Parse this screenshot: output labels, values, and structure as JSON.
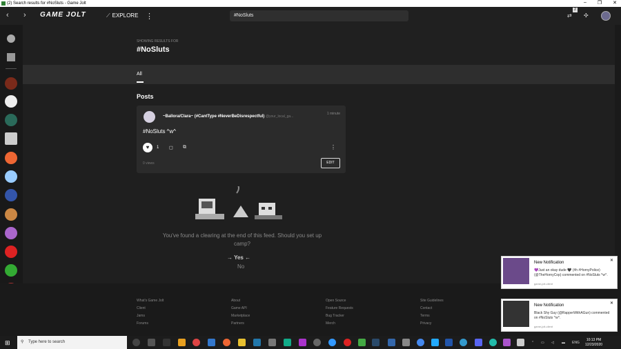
{
  "window": {
    "title": "(2) Search results for #NoSluts - Game Jolt",
    "controls": [
      "–",
      "❐",
      "✕"
    ]
  },
  "topbar": {
    "back": "‹",
    "forward": "›",
    "logo": "GAME JOLT",
    "explore_label": "EXPLORE",
    "explore_icon": "⟋",
    "menu_icon": "⋮",
    "search_value": "#NoSluts",
    "notif_count": "2",
    "icons": [
      "⇄",
      "✣"
    ]
  },
  "search_header": {
    "showing": "SHOWING RESULTS FOR",
    "query": "#NoSluts"
  },
  "tabs": [
    {
      "label": "All",
      "active": true
    }
  ],
  "posts_heading": "Posts",
  "post": {
    "author": "~Ballora/Clara~ (#CantType #NeverBeDisrespectful)",
    "handle": "@your_local_ga...",
    "time": "1 minute",
    "body": "#NoSluts ^w^",
    "like_icon": "♥",
    "like_count": "1",
    "comment_icon": "◻",
    "share_icon": "⧉",
    "more_icon": "⋮",
    "views": "0 views",
    "edit_label": "EDIT"
  },
  "end_feed": {
    "message": "You've found a clearing at the end of this feed. Should you set up camp?",
    "yes": "→ Yes ←",
    "no": "No"
  },
  "footer": {
    "col1": [
      "What's Game Jolt",
      "Client",
      "Jams",
      "Forums"
    ],
    "col2": [
      "About",
      "Game API",
      "Marketplace",
      "Partners"
    ],
    "col3": [
      "Open Source",
      "Feature Requests",
      "Bug Tracker",
      "Merch"
    ],
    "col4": [
      "Site Guidelines",
      "Contact",
      "Terms",
      "Privacy"
    ]
  },
  "notifications": [
    {
      "title": "New Notification",
      "body": "💜Just an okay dude 🖤 (#h #HornyPolice) (@TheHornyCop) commented on #NoSluts ^w^.",
      "source": "game-jolt-client",
      "thumb_color": "#6b4a8a"
    },
    {
      "title": "New Notification",
      "body": "Black Shy Guy (@RapperWithAGun) commented on #NoSluts ^w^.",
      "source": "game-jolt-client",
      "thumb_color": "#333333"
    }
  ],
  "taskbar": {
    "start_icon": "⊞",
    "search_placeholder": "Type here to search",
    "search_icon": "⚲",
    "tray_lang": "ENG",
    "time": "10:13 PM",
    "date": "12/23/2020"
  },
  "colors": {
    "bg": "#1f1f1f",
    "card": "#2b2b2b",
    "tabbar": "#2e2e2e",
    "accent_green": "#2f7f34"
  }
}
